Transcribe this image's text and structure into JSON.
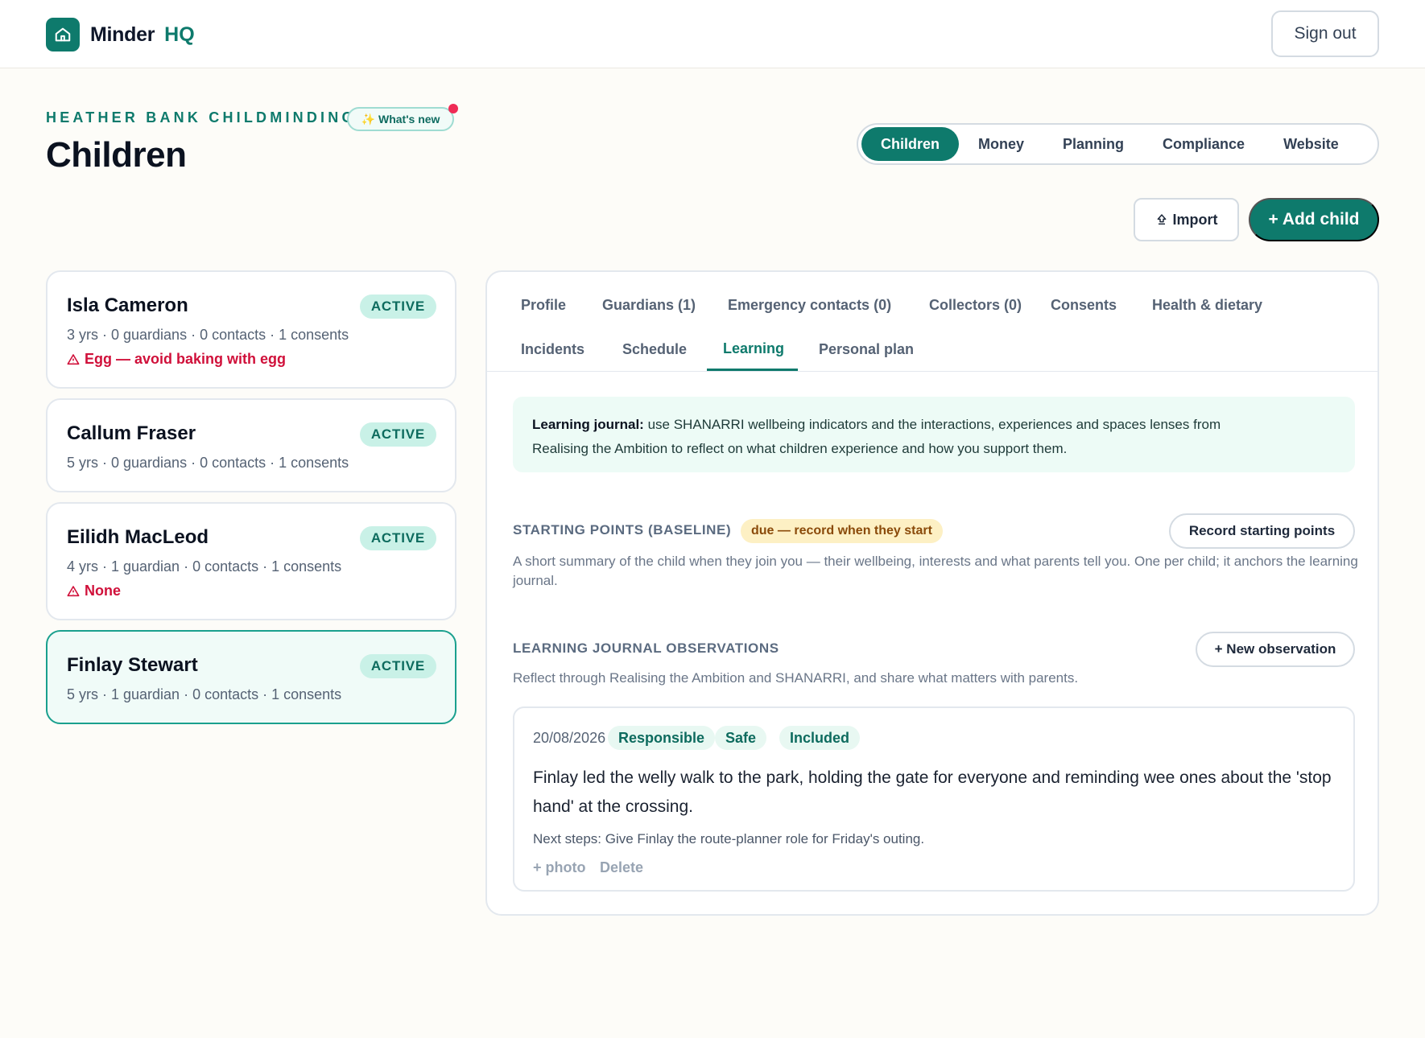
{
  "app": {
    "name": "Minder",
    "suffix": "HQ",
    "sign_out": "Sign out"
  },
  "header": {
    "eyebrow": "HEATHER BANK CHILDMINDING",
    "whats_new": "What's new",
    "title": "Children",
    "nav": [
      "Children",
      "Money",
      "Planning",
      "Compliance",
      "Website"
    ],
    "nav_active": "Children",
    "import_label": "Import",
    "add_label": "+ Add child"
  },
  "children": [
    {
      "name": "Isla Cameron",
      "status": "ACTIVE",
      "meta": "3 yrs · 0 guardians · 0 contacts · 1 consents",
      "alert": "Egg — avoid baking with egg"
    },
    {
      "name": "Callum Fraser",
      "status": "ACTIVE",
      "meta": "5 yrs · 0 guardians · 0 contacts · 1 consents"
    },
    {
      "name": "Eilidh MacLeod",
      "status": "ACTIVE",
      "meta": "4 yrs · 1 guardian · 0 contacts · 1 consents",
      "alert": "None"
    },
    {
      "name": "Finlay Stewart",
      "status": "ACTIVE",
      "meta": "5 yrs · 1 guardian · 0 contacts · 1 consents",
      "selected": true
    }
  ],
  "tabs": {
    "row1": [
      "Profile",
      "Guardians (1)",
      "Emergency contacts (0)",
      "Collectors (0)",
      "Consents",
      "Health & dietary"
    ],
    "row2": [
      "Incidents",
      "Schedule",
      "Learning",
      "Personal plan"
    ],
    "active": "Learning"
  },
  "learning": {
    "info_bold": "Learning journal:",
    "info_line1": " use SHANARRI wellbeing indicators and the interactions, experiences and spaces lenses from",
    "info_line2": "Realising the Ambition to reflect on what children experience and how you support them.",
    "baseline_title": "STARTING POINTS (BASELINE)",
    "baseline_badge": "due — record when they start",
    "baseline_button": "Record starting points",
    "baseline_desc": "A short summary of the child when they join you — their wellbeing, interests and what parents tell you. One per child; it anchors the learning journal.",
    "obs_title": "LEARNING JOURNAL OBSERVATIONS",
    "obs_button": "+ New observation",
    "obs_desc": "Reflect through Realising the Ambition and SHANARRI, and share what matters with parents.",
    "observation": {
      "date": "20/08/2026",
      "tags": [
        "Responsible",
        "Safe",
        "Included"
      ],
      "text": "Finlay led the welly walk to the park, holding the gate for everyone and reminding wee ones about the 'stop hand' at the crossing.",
      "next_steps": "Next steps: Give Finlay the route-planner role for Friday's outing.",
      "photo_action": "+ photo",
      "delete_action": "Delete"
    }
  },
  "icons": {
    "brand": "house-icon",
    "whats_new": "sparkles-icon",
    "import": "upload-icon",
    "alert": "warning-triangle-icon"
  },
  "colors": {
    "brand": "#0e7a6c",
    "alert": "#d0103a",
    "badge_bg": "#c9f1e7",
    "due_bg": "#fdf0c4",
    "page_bg": "#fdfcf8"
  }
}
